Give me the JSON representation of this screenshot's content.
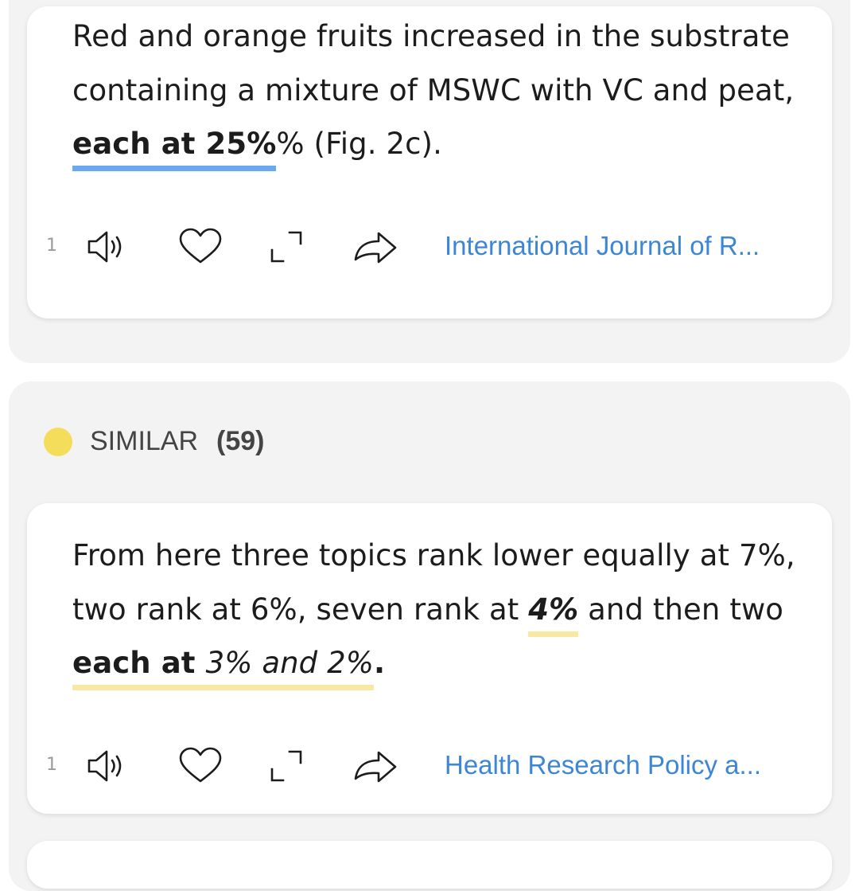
{
  "card1": {
    "text_before": "Red and orange fruits increased in the substrate containing a mixture of MSWC with VC and peat, ",
    "highlight": "each at 25%",
    "text_after": "% (Fig. 2c).",
    "count": "1",
    "source": "International Journal of R..."
  },
  "similar": {
    "label": "SIMILAR",
    "count": "(59)",
    "dot_color": "#f4dd5a"
  },
  "card2": {
    "text_1": "From here three topics rank lower equally at 7%, two rank at 6%, seven rank at ",
    "highlight_1": "4%",
    "text_2": " and then two ",
    "highlight_2_bold": "each at ",
    "highlight_2_italic": "3% and 2%",
    "text_3": ".",
    "count": "1",
    "source": "Health Research Policy a..."
  },
  "icons": [
    "speaker-icon",
    "heart-icon",
    "expand-icon",
    "share-icon"
  ],
  "colors": {
    "link": "#3d86d6",
    "underline_blue": "#6aa8ef",
    "underline_yellow": "#f7e9a3"
  }
}
